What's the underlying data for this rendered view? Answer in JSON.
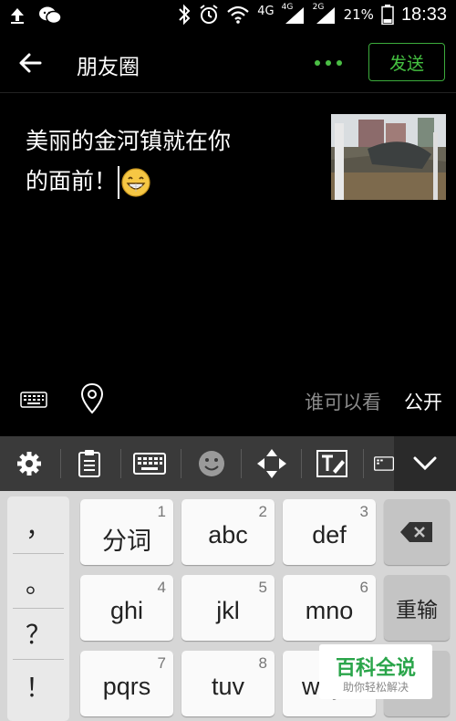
{
  "status_bar": {
    "network_4g": "4G",
    "signal_4g": "4G",
    "signal_2g": "2G",
    "battery": "21%",
    "time": "18:33"
  },
  "header": {
    "title": "朋友圈",
    "send_label": "发送"
  },
  "compose": {
    "text_line1": "美丽的金河镇就在你",
    "text_line2": "的面前！",
    "visibility_label": "谁可以看",
    "visibility_value": "公开"
  },
  "keyboard": {
    "punctuation": [
      "，",
      "。",
      "？",
      "！"
    ],
    "keys": [
      {
        "label": "分词",
        "num": "1"
      },
      {
        "label": "abc",
        "num": "2"
      },
      {
        "label": "def",
        "num": "3"
      },
      {
        "label": "ghi",
        "num": "4"
      },
      {
        "label": "jkl",
        "num": "5"
      },
      {
        "label": "mno",
        "num": "6"
      },
      {
        "label": "pqrs",
        "num": "7"
      },
      {
        "label": "tuv",
        "num": "8"
      },
      {
        "label": "wxyz",
        "num": "9"
      }
    ],
    "reenter_label": "重输"
  },
  "watermark": {
    "title": "百科全说",
    "subtitle": "助你轻松解决"
  },
  "colors": {
    "accent_green": "#45c241",
    "ime_bar": "#3a3a3a",
    "keyboard_bg": "#d6d6d6"
  }
}
